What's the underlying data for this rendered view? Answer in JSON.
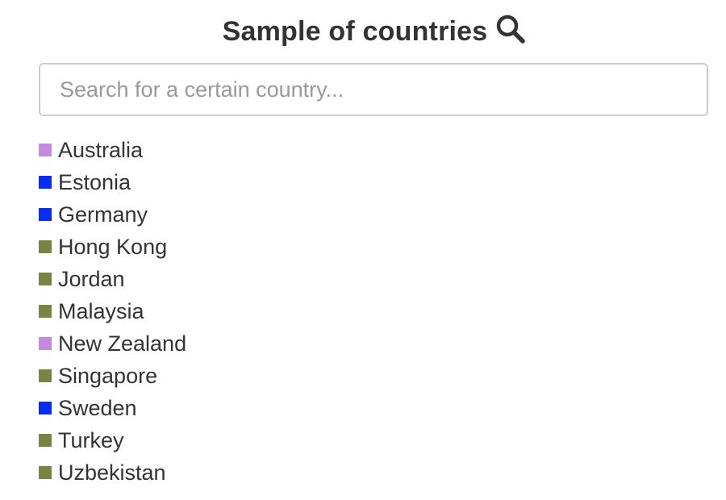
{
  "header": {
    "title": "Sample of countries",
    "icon": "search-icon"
  },
  "search": {
    "placeholder": "Search for a certain country...",
    "value": ""
  },
  "colors": {
    "purple": "#c58ae0",
    "blue": "#0a2ef0",
    "olive": "#7b8343"
  },
  "countries": [
    {
      "name": "Australia",
      "color": "#c58ae0"
    },
    {
      "name": "Estonia",
      "color": "#0a2ef0"
    },
    {
      "name": "Germany",
      "color": "#0a2ef0"
    },
    {
      "name": "Hong Kong",
      "color": "#7b8343"
    },
    {
      "name": "Jordan",
      "color": "#7b8343"
    },
    {
      "name": "Malaysia",
      "color": "#7b8343"
    },
    {
      "name": "New Zealand",
      "color": "#c58ae0"
    },
    {
      "name": "Singapore",
      "color": "#7b8343"
    },
    {
      "name": "Sweden",
      "color": "#0a2ef0"
    },
    {
      "name": "Turkey",
      "color": "#7b8343"
    },
    {
      "name": "Uzbekistan",
      "color": "#7b8343"
    }
  ]
}
